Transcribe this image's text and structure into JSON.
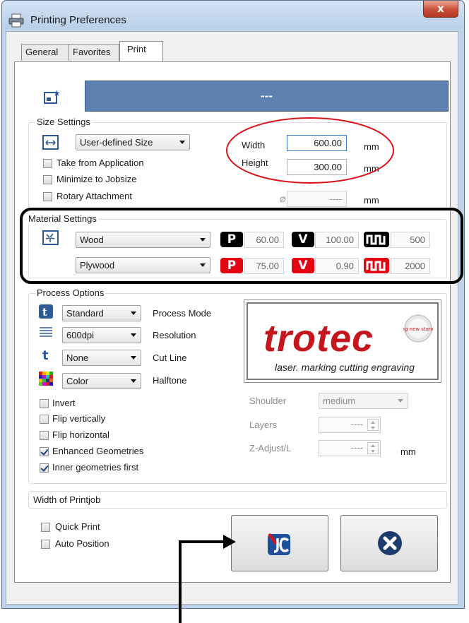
{
  "window": {
    "title": "Printing Preferences",
    "close_glyph": "x"
  },
  "tabs": [
    {
      "label": "General"
    },
    {
      "label": "Favorites"
    },
    {
      "label": "Print"
    }
  ],
  "banner": {
    "text": "---"
  },
  "size_settings": {
    "label": "Size Settings",
    "size_select": "User-defined Size",
    "take_from_application": "Take from Application",
    "minimize_to_jobsize": "Minimize to Jobsize",
    "rotary_attachment": "Rotary Attachment",
    "width_label": "Width",
    "width_value": "600.00",
    "height_label": "Height",
    "height_value": "300.00",
    "unit": "mm",
    "diameter_symbol": "Ø",
    "diameter_value": "----"
  },
  "material_settings": {
    "label": "Material Settings",
    "material": "Wood",
    "submaterial": "Plywood",
    "row1": {
      "p": "60.00",
      "v": "100.00",
      "freq": "500"
    },
    "row2": {
      "p": "75.00",
      "v": "0.90",
      "freq": "2000"
    },
    "p_badge": "P",
    "v_badge": "V"
  },
  "process_options": {
    "label": "Process Options",
    "process_mode_value": "Standard",
    "process_mode_label": "Process Mode",
    "resolution_value": "600dpi",
    "resolution_label": "Resolution",
    "cut_line_value": "None",
    "cut_line_label": "Cut Line",
    "halftone_value": "Color",
    "halftone_label": "Halftone",
    "invert": "Invert",
    "flip_vertically": "Flip vertically",
    "flip_horizontal": "Flip horizontal",
    "enhanced_geometries": "Enhanced Geometries",
    "inner_geometries_first": "Inner geometries first",
    "shoulder_label": "Shoulder",
    "shoulder_value": "medium",
    "layers_label": "Layers",
    "layers_value": "----",
    "z_adjust_label": "Z-Adjust/L",
    "z_adjust_value": "----",
    "z_adjust_unit": "mm"
  },
  "logo": {
    "brand": "trotec",
    "tagline": "laser. marking cutting engraving",
    "seal": "setting new standards"
  },
  "width_of_printjob": {
    "label": "Width of Printjob"
  },
  "bottom": {
    "quick_print": "Quick Print",
    "auto_position": "Auto Position"
  },
  "colors": {
    "banner": "#5e80b1",
    "annotation_red": "#d9141c",
    "badge_red": "#e20612",
    "trotec_red": "#c4161c"
  }
}
